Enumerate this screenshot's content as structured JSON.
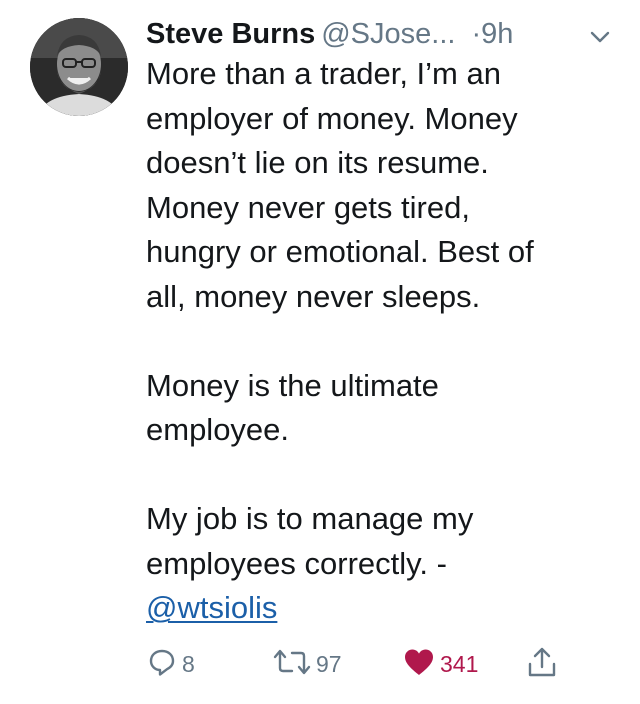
{
  "tweet": {
    "author_name": "Steve Burns",
    "author_handle": "@SJose...",
    "separator": "·",
    "timestamp": "9h",
    "paragraphs": [
      [
        "More than a trader, I’m an",
        "employer of money.  Money",
        "doesn’t lie on its resume.",
        "Money never gets tired,",
        "hungry or emotional.  Best of",
        "all, money never sleeps."
      ],
      [
        "Money is the ultimate",
        "employee."
      ],
      [
        "My job is to manage my",
        "employees correctly. -"
      ]
    ],
    "mention": "@wtsiolis"
  },
  "actions": {
    "reply_count": "8",
    "retweet_count": "97",
    "like_count": "341",
    "like_color": "#b0184c"
  },
  "icons": {
    "avatar": "avatar-photo",
    "menu": "chevron-down-icon",
    "reply": "reply-icon",
    "retweet": "retweet-icon",
    "like": "heart-icon",
    "share": "share-icon"
  }
}
